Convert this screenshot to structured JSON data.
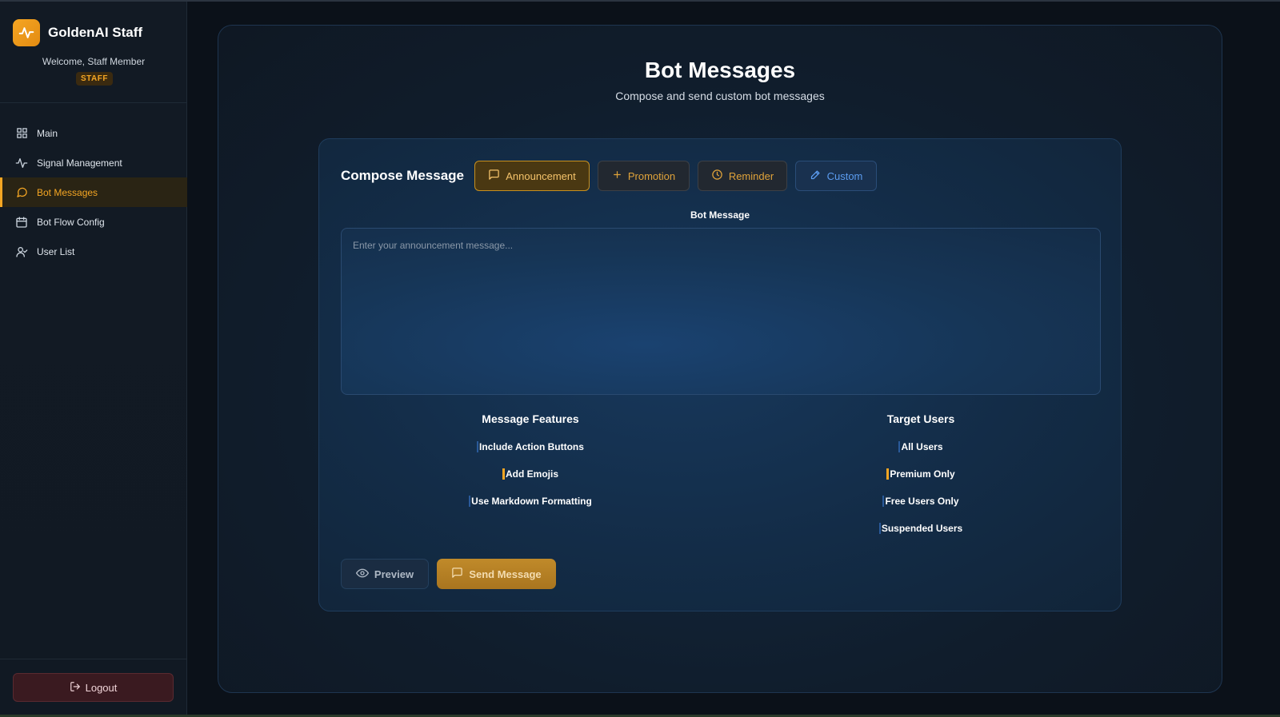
{
  "sidebar": {
    "brand": "GoldenAI Staff",
    "welcome": "Welcome, Staff Member",
    "role_badge": "STAFF",
    "items": [
      {
        "label": "Main",
        "icon": "grid-icon"
      },
      {
        "label": "Signal Management",
        "icon": "activity-icon"
      },
      {
        "label": "Bot Messages",
        "icon": "message-icon",
        "active": true
      },
      {
        "label": "Bot Flow Config",
        "icon": "calendar-icon"
      },
      {
        "label": "User List",
        "icon": "user-icon"
      }
    ],
    "logout_label": "Logout"
  },
  "main": {
    "title": "Bot Messages",
    "subtitle": "Compose and send custom bot messages",
    "compose": {
      "title": "Compose Message",
      "tabs": [
        {
          "label": "Announcement",
          "icon": "message-icon",
          "active": true
        },
        {
          "label": "Promotion",
          "icon": "plus-icon"
        },
        {
          "label": "Reminder",
          "icon": "clock-icon"
        },
        {
          "label": "Custom",
          "icon": "pen-icon"
        }
      ],
      "message_label": "Bot Message",
      "message_value": "",
      "message_placeholder": "Enter your announcement message...",
      "features": {
        "title": "Message Features",
        "options": [
          {
            "label": "Include Action Buttons",
            "checked": false
          },
          {
            "label": "Add Emojis",
            "checked": true
          },
          {
            "label": "Use Markdown Formatting",
            "checked": false
          }
        ]
      },
      "targets": {
        "title": "Target Users",
        "options": [
          {
            "label": "All Users",
            "checked": false
          },
          {
            "label": "Premium Only",
            "checked": true
          },
          {
            "label": "Free Users Only",
            "checked": false
          },
          {
            "label": "Suspended Users",
            "checked": false
          }
        ]
      },
      "preview_label": "Preview",
      "send_label": "Send Message"
    }
  },
  "colors": {
    "accent": "#f5a623",
    "background": "#0b1119",
    "custom_tab": "#5b9cf0"
  }
}
